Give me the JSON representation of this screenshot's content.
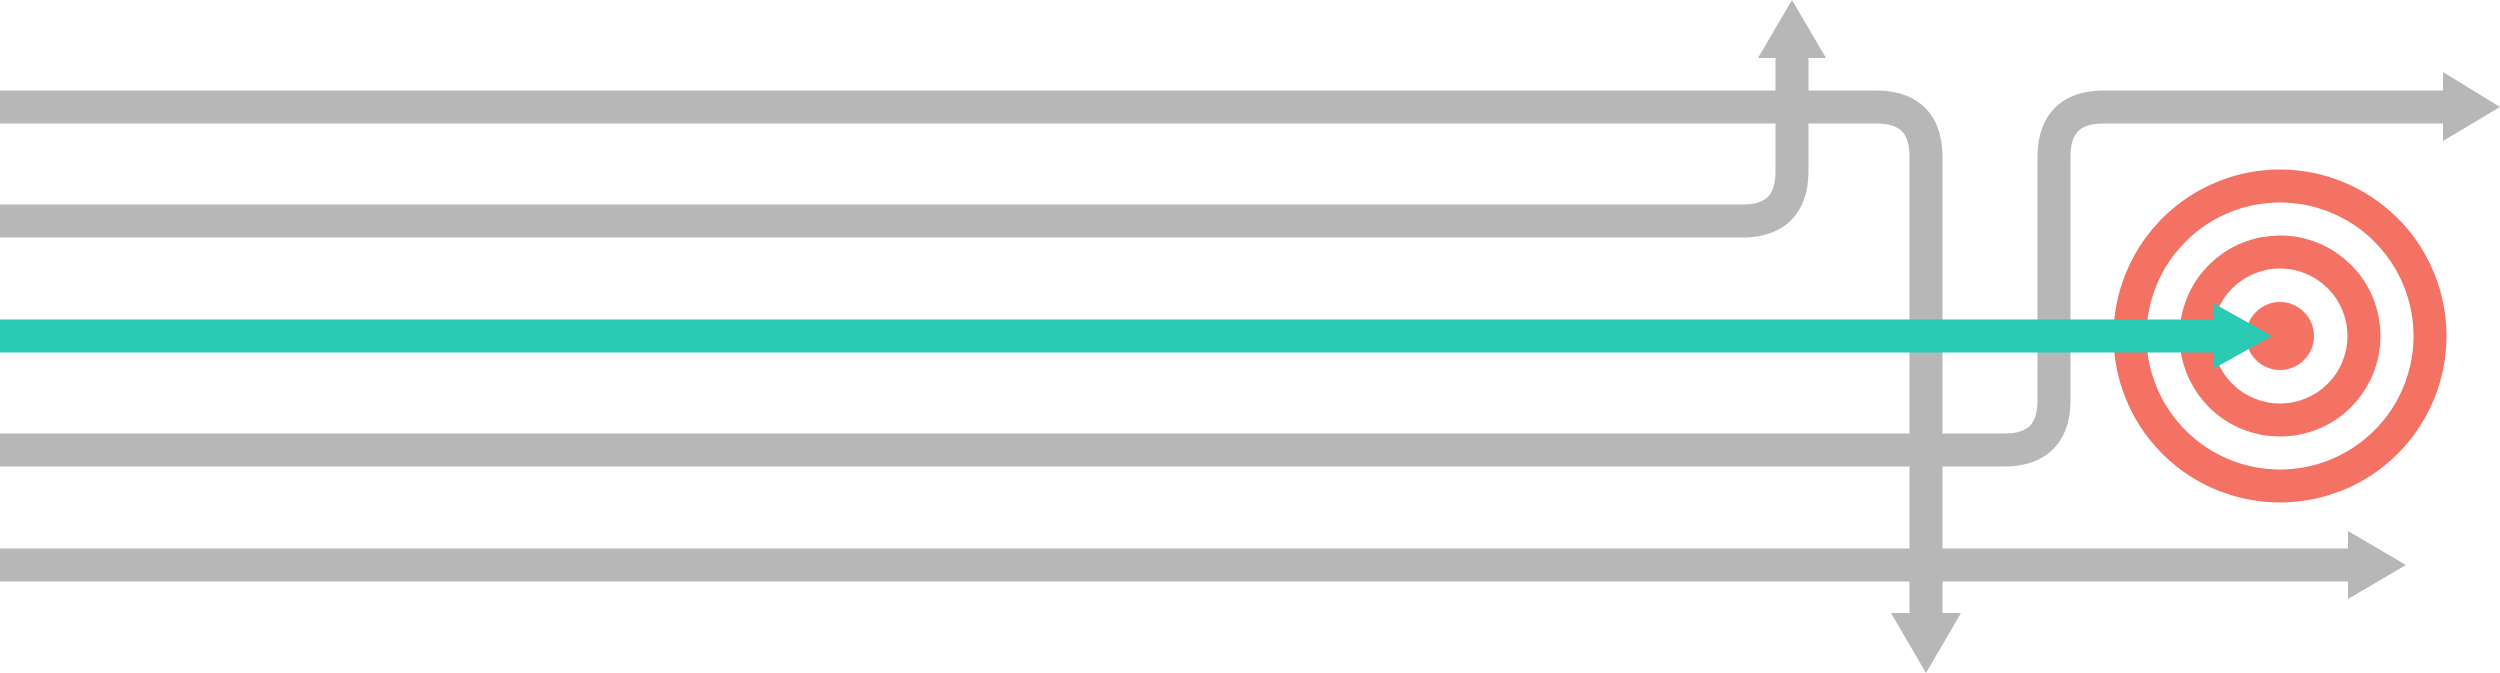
{
  "colors": {
    "background": "#ffffff",
    "gray_path": "#b7b7b7",
    "accent_path": "#2bcab5",
    "target": "#f37263"
  },
  "icons": {
    "paths": "gray-arrow-paths",
    "direct_path": "teal-arrow",
    "target": "bullseye-icon"
  }
}
